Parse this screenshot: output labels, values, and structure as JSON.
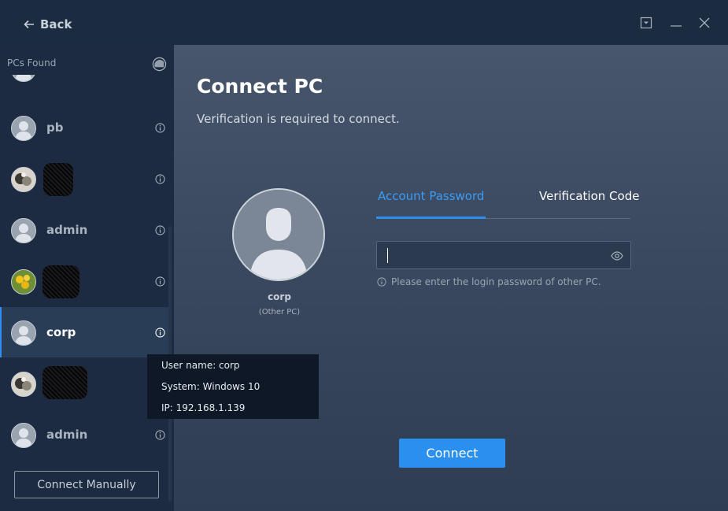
{
  "header": {
    "back_label": "Back"
  },
  "sidebar": {
    "title": "PCs Found",
    "items": [
      {
        "name": "pb"
      },
      {
        "name": ""
      },
      {
        "name": "admin"
      },
      {
        "name": ""
      },
      {
        "name": "corp",
        "selected": true
      },
      {
        "name": ""
      },
      {
        "name": "admin"
      }
    ],
    "connect_manually_label": "Connect Manually"
  },
  "tooltip": {
    "user": "User name: corp",
    "system": "System: Windows 10",
    "ip": "IP: 192.168.1.139"
  },
  "main": {
    "title": "Connect PC",
    "subtitle": "Verification is required to connect.",
    "target_name": "corp",
    "target_sub": "(Other PC)",
    "tabs": [
      {
        "label": "Account Password",
        "active": true
      },
      {
        "label": "Verification Code",
        "active": false
      }
    ],
    "password_value": "",
    "hint": "Please enter the login password of other PC.",
    "connect_label": "Connect"
  },
  "colors": {
    "accent": "#2e8ff0",
    "sidebar_bg": "#1c2b41",
    "selected_bg": "#2a3d57",
    "tooltip_bg": "#0f1826"
  }
}
